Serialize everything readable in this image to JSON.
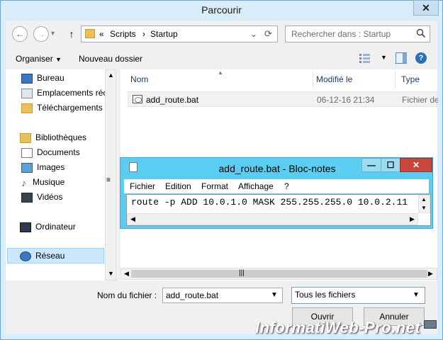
{
  "window": {
    "title": "Parcourir",
    "close": "✕"
  },
  "nav": {
    "back": "←",
    "forward": "→",
    "up": "↑"
  },
  "address": {
    "chevrons": "«",
    "crumbs": [
      "Scripts",
      "Startup"
    ],
    "sep": "›",
    "dropdown": "⌄",
    "refresh": "⟳"
  },
  "search": {
    "placeholder": "Rechercher dans : Startup",
    "icon": "🔍"
  },
  "toolbar": {
    "organize": "Organiser",
    "new_folder": "Nouveau dossier",
    "help": "?"
  },
  "sidebar": {
    "favorites": [
      "Bureau",
      "Emplacements récents",
      "Téléchargements"
    ],
    "libraries_header": "Bibliothèques",
    "libraries": [
      "Documents",
      "Images",
      "Musique",
      "Vidéos"
    ],
    "computer": "Ordinateur",
    "network": "Réseau"
  },
  "columns": {
    "name": "Nom",
    "modified": "Modifié le",
    "type": "Type"
  },
  "files": [
    {
      "name": "add_route.bat",
      "modified": "06-12-16 21:34",
      "type": "Fichier de commandes Windows"
    }
  ],
  "notepad": {
    "title": "add_route.bat - Bloc-notes",
    "menu": [
      "Fichier",
      "Edition",
      "Format",
      "Affichage",
      "?"
    ],
    "content": "route -p ADD 10.0.1.0 MASK 255.255.255.0 10.0.2.11",
    "buttons": {
      "min": "—",
      "max": "☐",
      "close": "✕"
    }
  },
  "footer": {
    "filename_label": "Nom du fichier :",
    "filename_value": "add_route.bat",
    "filetype": "Tous les fichiers",
    "open": "Ouvrir",
    "cancel": "Annuler"
  },
  "watermark": "InformatiWeb-Pro.net",
  "colors": {
    "accent": "#5bcdf0",
    "frame": "#d8ecf9"
  }
}
